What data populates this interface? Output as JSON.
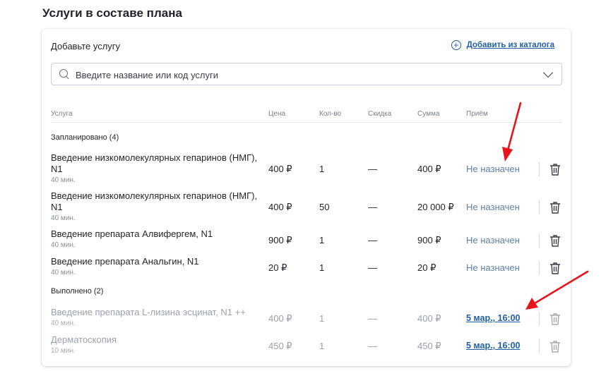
{
  "title": "Услуги в составе плана",
  "add_service": {
    "label": "Добавьте услугу",
    "catalog_link": "Добавить из каталога",
    "catalog_icon": "plus-circle-icon",
    "search": {
      "placeholder": "Введите название или код услуги",
      "value": "",
      "icon": "search-icon",
      "dropdown_icon": "chevron-down-icon"
    }
  },
  "table": {
    "columns": [
      "Услуга",
      "Цена",
      "Кол-во",
      "Скидка",
      "Сумма",
      "Приём"
    ],
    "groups": [
      {
        "label": "Запланировано (4)",
        "rows": [
          {
            "name": "Введение низкомолекулярных гепаринов (НМГ), N1",
            "duration": "40 мин.",
            "price": "400 ₽",
            "qty": "1",
            "discount": "—",
            "sum": "400 ₽",
            "appointment": "Не назначен"
          },
          {
            "name": "Введение низкомолекулярных гепаринов (НМГ), N1",
            "duration": "40 мин.",
            "price": "400 ₽",
            "qty": "50",
            "discount": "—",
            "sum": "20 000 ₽",
            "appointment": "Не назначен"
          },
          {
            "name": "Введение препарата Алвифергем, N1",
            "duration": "40 мин.",
            "price": "900 ₽",
            "qty": "1",
            "discount": "—",
            "sum": "900 ₽",
            "appointment": "Не назначен"
          },
          {
            "name": "Введение препарата Анальгин, N1",
            "duration": "40 мин.",
            "price": "20 ₽",
            "qty": "1",
            "discount": "—",
            "sum": "20 ₽",
            "appointment": "Не назначен"
          }
        ]
      },
      {
        "label": "Выполнено (2)",
        "rows": [
          {
            "name": "Введение препарата L-лизина эсцинат, N1 ++",
            "duration": "40 мин.",
            "price": "400 ₽",
            "qty": "1",
            "discount": "—",
            "sum": "400 ₽",
            "appointment": "5 мар., 16:00"
          },
          {
            "name": "Дерматоскопия",
            "duration": "10 мин.",
            "price": "450 ₽",
            "qty": "1",
            "discount": "—",
            "sum": "450 ₽",
            "appointment": "5 мар., 16:00"
          }
        ]
      }
    ]
  },
  "colors": {
    "link": "#1f5fa8",
    "muted": "#9aa1ab",
    "annotation_arrow": "#e8141b"
  },
  "row_icon": "trash-icon"
}
